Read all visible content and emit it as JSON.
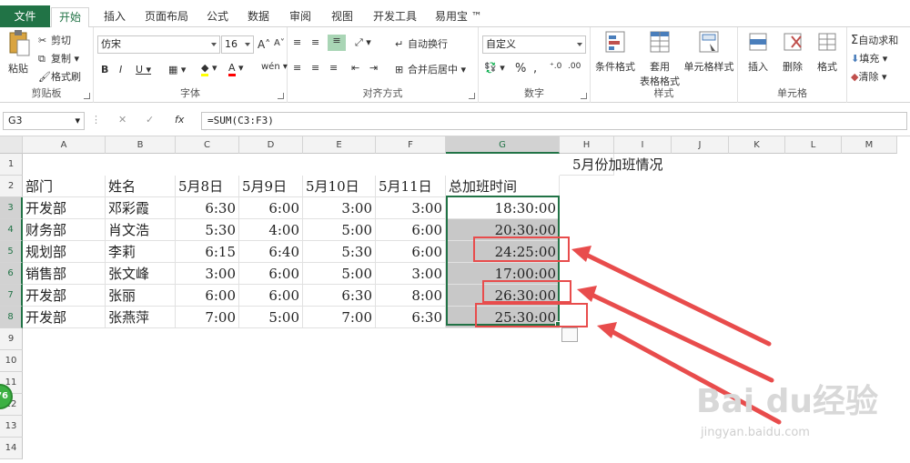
{
  "ribbon_tabs": [
    "文件",
    "开始",
    "插入",
    "页面布局",
    "公式",
    "数据",
    "审阅",
    "视图",
    "开发工具",
    "易用宝 ™"
  ],
  "clipboard": {
    "paste": "粘贴",
    "cut": "剪切",
    "copy": "复制",
    "format_painter": "格式刷",
    "label": "剪贴板"
  },
  "font": {
    "name": "仿宋",
    "size": "16",
    "label": "字体"
  },
  "alignment": {
    "wrap": "自动换行",
    "merge": "合并后居中",
    "label": "对齐方式"
  },
  "number": {
    "format": "自定义",
    "label": "数字"
  },
  "styles": {
    "conditional": "条件格式",
    "table1": "套用",
    "table2": "表格格式",
    "cell_styles": "单元格样式",
    "label": "样式"
  },
  "cells": {
    "insert": "插入",
    "delete": "删除",
    "format": "格式",
    "label": "单元格"
  },
  "editing": {
    "autosum": "自动求和",
    "fill": "填充",
    "clear": "清除"
  },
  "name_box": "G3",
  "formula": "=SUM(C3:F3)",
  "columns": [
    "A",
    "B",
    "C",
    "D",
    "E",
    "F",
    "G",
    "H",
    "I",
    "J",
    "K",
    "L",
    "M"
  ],
  "rows": [
    "1",
    "2",
    "3",
    "4",
    "5",
    "6",
    "7",
    "8",
    "9",
    "10",
    "11",
    "12",
    "13",
    "14"
  ],
  "sheet": {
    "title": "5月份加班情况",
    "headers": [
      "部门",
      "姓名",
      "5月8日",
      "5月9日",
      "5月10日",
      "5月11日",
      "总加班时间"
    ],
    "data": [
      [
        "开发部",
        "邓彩霞",
        "6:30",
        "6:00",
        "3:00",
        "3:00",
        "18:30:00"
      ],
      [
        "财务部",
        "肖文浩",
        "5:30",
        "4:00",
        "5:00",
        "6:00",
        "20:30:00"
      ],
      [
        "规划部",
        "李莉",
        "6:15",
        "6:40",
        "5:30",
        "6:00",
        "24:25:00"
      ],
      [
        "销售部",
        "张文峰",
        "3:00",
        "6:00",
        "5:00",
        "3:00",
        "17:00:00"
      ],
      [
        "开发部",
        "张丽",
        "6:00",
        "6:00",
        "6:30",
        "8:00",
        "26:30:00"
      ],
      [
        "开发部",
        "张燕萍",
        "7:00",
        "5:00",
        "7:00",
        "6:30",
        "25:30:00"
      ]
    ]
  },
  "watermark": {
    "brand": "Bai du经验",
    "url": "jingyan.baidu.com"
  },
  "badge": "76",
  "colors": {
    "excel_green": "#217346",
    "highlight_red": "#e84c4c",
    "selection_shade": "#c8c8c8"
  }
}
